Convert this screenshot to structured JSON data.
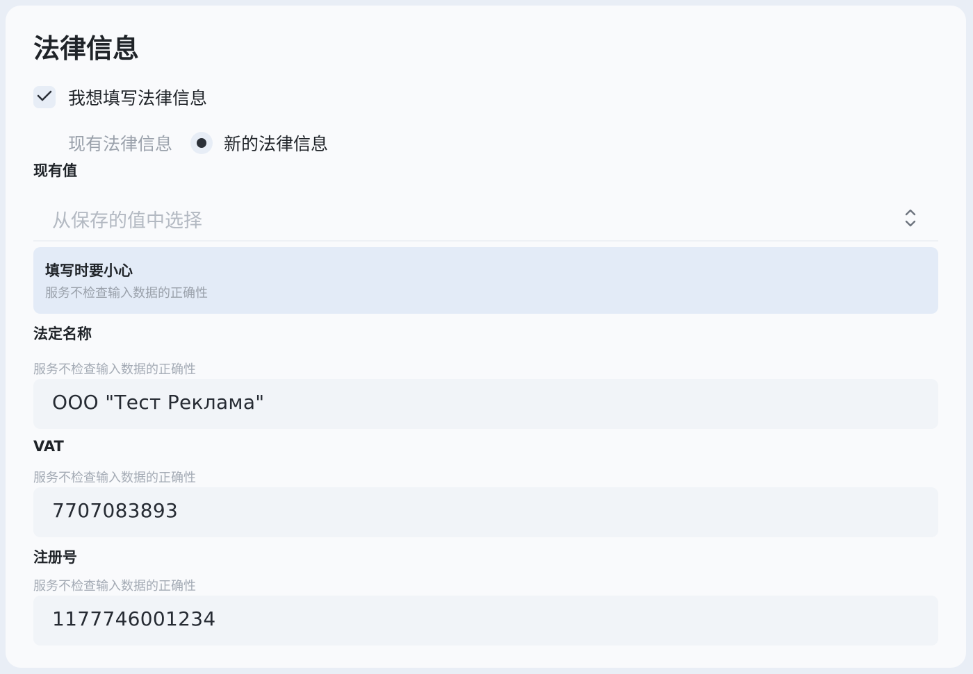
{
  "section": {
    "title": "法律信息"
  },
  "checkbox": {
    "label": "我想填写法律信息",
    "checked": true
  },
  "radio": {
    "existing_label": "现有法律信息",
    "new_label": "新的法律信息",
    "selected": "new"
  },
  "existing_value": {
    "label": "现有值",
    "placeholder": "从保存的值中选择"
  },
  "notice": {
    "title": "填写时要小心",
    "text": "服务不检查输入数据的正确性"
  },
  "fields": {
    "legal_name": {
      "label": "法定名称",
      "hint": "服务不检查输入数据的正确性",
      "value": "ООО \"Тест Реклама\""
    },
    "vat": {
      "label": "VAT",
      "hint": "服务不检查输入数据的正确性",
      "value": "7707083893"
    },
    "reg_number": {
      "label": "注册号",
      "hint": "服务不检查输入数据的正确性",
      "value": "1177746001234"
    }
  },
  "icons": {
    "checkbox": "check-icon",
    "select": "chevron-up-down-icon"
  },
  "colors": {
    "card_background": "#f9fafc",
    "page_background": "#e9eef6",
    "notice_background": "#e3ebf7",
    "input_background": "#f1f4f8"
  }
}
